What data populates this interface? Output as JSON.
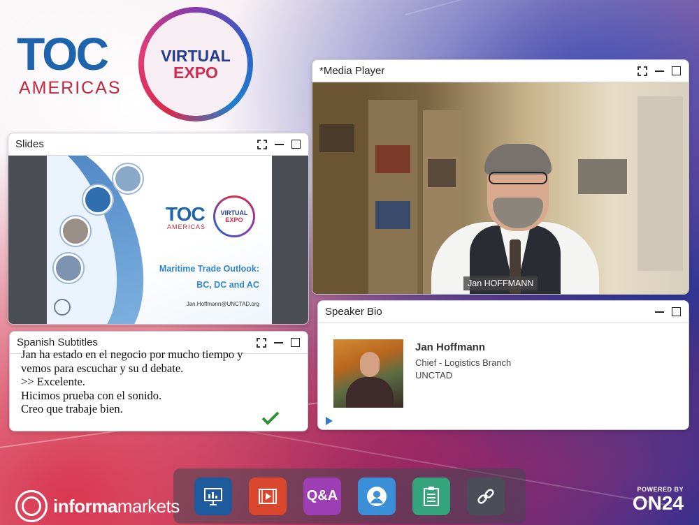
{
  "branding": {
    "toc_word": "TOC",
    "toc_sub": "AMERICAS",
    "expo_line1": "VIRTUAL",
    "expo_line2": "EXPO",
    "informa_prefix": "informa",
    "informa_suffix": "markets",
    "on24_powered": "POWERED BY",
    "on24_name": "ON24"
  },
  "slides_panel": {
    "title": "Slides",
    "slide": {
      "toc_word": "TOC",
      "toc_sub": "AMERICAS",
      "expo_line1": "VIRTUAL",
      "expo_line2": "EXPO",
      "title_line1": "Maritime Trade Outlook:",
      "title_line2": "BC, DC and AC",
      "email": "Jan.Hoffmann@UNCTAD.org"
    }
  },
  "subtitles_panel": {
    "title": "Spanish Subtitles",
    "lines": [
      "Jan ha estado en el negocio por mucho tiempo y",
      "vemos para escuchar y su d debate.",
      ">> Excelente.",
      "Hicimos prueba con el sonido.",
      "Creo que trabaje bien."
    ]
  },
  "media_panel": {
    "title": "*Media Player",
    "name_tag": "Jan HOFFMANN"
  },
  "bio_panel": {
    "title": "Speaker Bio",
    "name": "Jan Hoffmann",
    "role": "Chief - Logistics Branch",
    "org": "UNCTAD"
  },
  "dock": {
    "qa_label": "Q&A"
  },
  "colors": {
    "toc_blue": "#1d64ad",
    "americas_red": "#c4263d",
    "check_green": "#2f8f3a"
  }
}
